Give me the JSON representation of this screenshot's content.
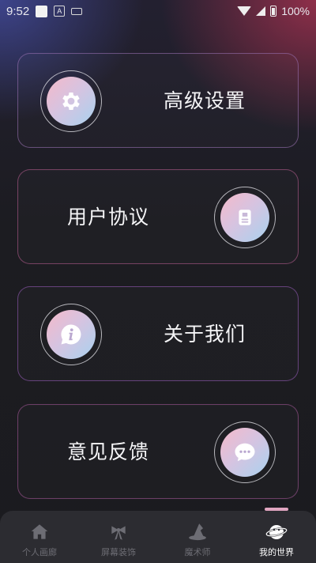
{
  "status_bar": {
    "time": "9:52",
    "battery": "100%"
  },
  "menu": [
    {
      "label": "高级设置",
      "icon": "gear-icon"
    },
    {
      "label": "用户协议",
      "icon": "document-icon"
    },
    {
      "label": "关于我们",
      "icon": "info-icon"
    },
    {
      "label": "意见反馈",
      "icon": "chat-bubble-icon"
    }
  ],
  "nav": [
    {
      "label": "个人画廊",
      "icon": "home-icon",
      "active": false
    },
    {
      "label": "屏幕装饰",
      "icon": "bow-icon",
      "active": false
    },
    {
      "label": "魔术师",
      "icon": "wizard-hat-icon",
      "active": false
    },
    {
      "label": "我的世界",
      "icon": "planet-icon",
      "active": true
    }
  ],
  "colors": {
    "background": "#1b1b1f",
    "nav_background": "#2c2c31",
    "active_label": "#ffffff",
    "inactive_label": "#6d6d74",
    "icon_gradient_pink": "#f5b9c9",
    "icon_gradient_blue": "#a9d2ef"
  }
}
